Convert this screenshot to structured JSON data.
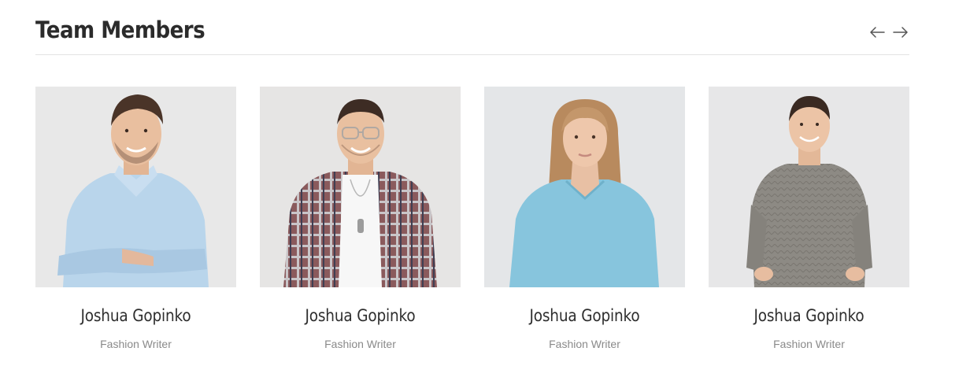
{
  "section": {
    "title": "Team Members"
  },
  "nav": {
    "prev_icon": "arrow-left-icon",
    "next_icon": "arrow-right-icon"
  },
  "members": [
    {
      "name": "Joshua Gopinko",
      "role": "Fashion Writer",
      "photo": {
        "top_color": "#b8d4ea",
        "top_style": "shirt",
        "hair": "#4a3428"
      }
    },
    {
      "name": "Joshua Gopinko",
      "role": "Fashion Writer",
      "photo": {
        "top_color": "#7a4b4d",
        "top_style": "plaid",
        "hair": "#3d2c24"
      }
    },
    {
      "name": "Joshua Gopinko",
      "role": "Fashion Writer",
      "photo": {
        "top_color": "#86c4dc",
        "top_style": "sweater",
        "hair": "#b88a5e"
      }
    },
    {
      "name": "Joshua Gopinko",
      "role": "Fashion Writer",
      "photo": {
        "top_color": "#8c8983",
        "top_style": "knit",
        "hair": "#3a2a22"
      }
    }
  ],
  "colors": {
    "title": "#2b2b2b",
    "name": "#2e2e2e",
    "role": "#8a8a8a",
    "divider": "#e3e3e3",
    "photo_background": "#e9e9e9"
  }
}
